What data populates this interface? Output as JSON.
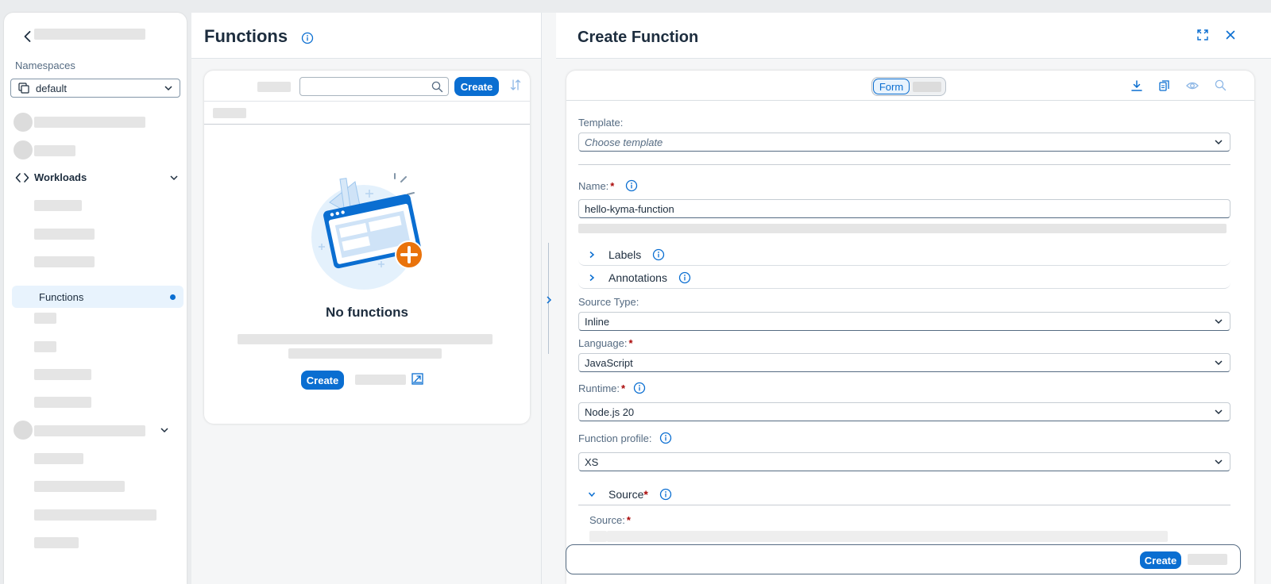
{
  "sidebar": {
    "namespaces_label": "Namespaces",
    "namespace_value": "default",
    "workloads_label": "Workloads",
    "active_item": "Functions"
  },
  "list_panel": {
    "title": "Functions",
    "toolbar_create": "Create",
    "empty_title": "No functions",
    "empty_create": "Create"
  },
  "create_panel": {
    "title": "Create Function",
    "mode_form": "Form",
    "template_label": "Template:",
    "template_placeholder": "Choose template",
    "name_label": "Name:",
    "name_value": "hello-kyma-function",
    "labels_section": "Labels",
    "annotations_section": "Annotations",
    "source_type_label": "Source Type:",
    "source_type_value": "Inline",
    "language_label": "Language:",
    "language_value": "JavaScript",
    "runtime_label": "Runtime:",
    "runtime_value": "Node.js 20",
    "profile_label": "Function profile:",
    "profile_value": "XS",
    "source_section": "Source",
    "source_label": "Source:",
    "required_marker": "*",
    "footer_create": "Create"
  },
  "colors": {
    "brand": "#0a6ed1",
    "required": "#aa0808",
    "accent_orange": "#e9730c"
  }
}
